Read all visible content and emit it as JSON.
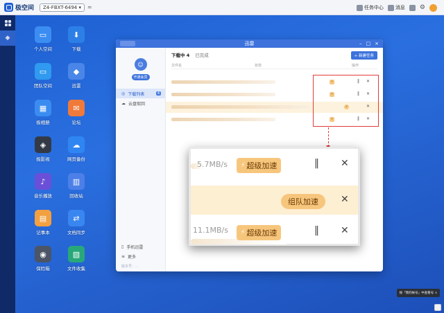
{
  "topbar": {
    "brand": "极空间",
    "device": "Z4-FBXT-6494 ▾",
    "task_center": "任务中心",
    "messages": "消息"
  },
  "desktop": {
    "icons": [
      {
        "label": "个人空间",
        "color": "#3b8df2"
      },
      {
        "label": "下载",
        "color": "#2c7fe6"
      },
      {
        "label": "团队空间",
        "color": "#2f9af0"
      },
      {
        "label": "迅雷",
        "color": "#4a86e8"
      },
      {
        "label": "极相册",
        "color": "#3a8cf0"
      },
      {
        "label": "论坛",
        "color": "#f07a3a"
      },
      {
        "label": "极影视",
        "color": "#333a46"
      },
      {
        "label": "网页备份",
        "color": "#2f86f2"
      },
      {
        "label": "音乐播放",
        "color": "#6a4fd8"
      },
      {
        "label": "回收站",
        "color": "#4d7fe8"
      },
      {
        "label": "记事本",
        "color": "#f2a040"
      },
      {
        "label": "文档同步",
        "color": "#3a86f0"
      },
      {
        "label": "保险箱",
        "color": "#4b5566"
      },
      {
        "label": "文件收集",
        "color": "#28a87a"
      }
    ]
  },
  "window": {
    "title": "迅雷",
    "tag": "",
    "sidebar": {
      "vip_button": "开通会员",
      "items": [
        {
          "label": "下载列表",
          "count": "4"
        },
        {
          "label": "云盘取回"
        }
      ],
      "bottom": [
        {
          "label": "手机迅雷"
        },
        {
          "label": "更多"
        }
      ],
      "version": "版本号：..."
    },
    "tabs": {
      "downloading": "下载中 4",
      "completed": "已完成"
    },
    "new_task": "+ 新建任务",
    "columns": {
      "name": "文件名",
      "status": "状态",
      "action": "操作"
    }
  },
  "zoom": {
    "rows": [
      {
        "speed": "5.7MB/s",
        "boost": "超级加速"
      },
      {
        "team": "组队加速"
      },
      {
        "speed": "11.1MB/s",
        "boost": "超级加速"
      }
    ]
  },
  "toast": "按「我的帐号」中查看号 ×"
}
